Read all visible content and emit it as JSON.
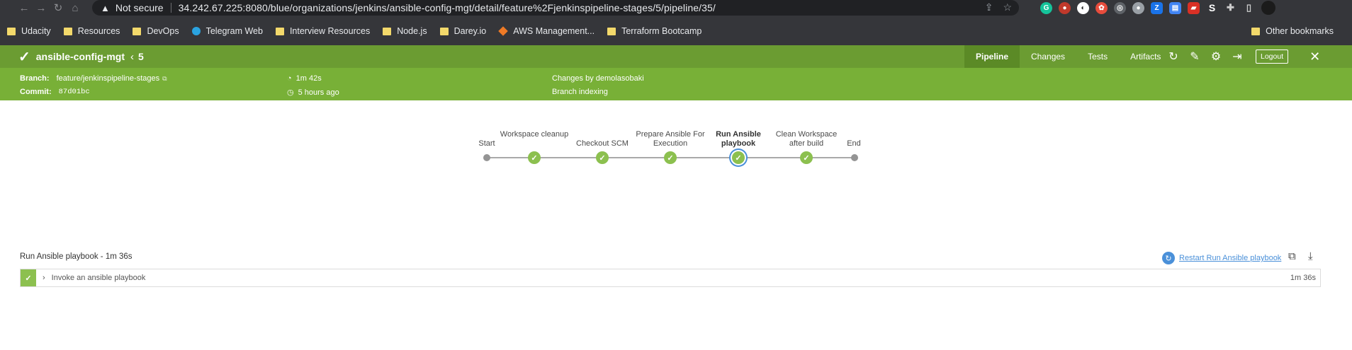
{
  "browser": {
    "not_secure": "Not secure",
    "url": "34.242.67.225:8080/blue/organizations/jenkins/ansible-config-mgt/detail/feature%2Fjenkinspipeline-stages/5/pipeline/35/",
    "bookmarks": [
      "Udacity",
      "Resources",
      "DevOps",
      "Telegram Web",
      "Interview Resources",
      "Node.js",
      "Darey.io",
      "AWS Management...",
      "Terraform Bootcamp"
    ],
    "other_bookmarks": "Other bookmarks"
  },
  "header": {
    "job_name": "ansible-config-mgt",
    "run_number": "5",
    "tabs": [
      "Pipeline",
      "Changes",
      "Tests",
      "Artifacts"
    ],
    "logout": "Logout"
  },
  "summary": {
    "branch_label": "Branch:",
    "branch_value": "feature/jenkinspipeline-stages",
    "commit_label": "Commit:",
    "commit_value": "87d01bc",
    "duration": "1m 42s",
    "time_ago": "5 hours ago",
    "changes": "Changes by demolasobaki",
    "cause": "Branch indexing"
  },
  "pipeline": {
    "stages": [
      {
        "label": "Start"
      },
      {
        "label": "Workspace cleanup"
      },
      {
        "label": "Checkout SCM"
      },
      {
        "label": "Prepare Ansible For Execution"
      },
      {
        "label": "Run Ansible playbook"
      },
      {
        "label": "Clean Workspace after build"
      },
      {
        "label": "End"
      }
    ]
  },
  "details": {
    "title": "Run Ansible playbook - 1m 36s",
    "restart_label": "Restart Run Ansible playbook",
    "step_name": "Invoke an ansible playbook",
    "step_duration": "1m 36s"
  },
  "colors": {
    "header_green": "#6b9c32",
    "subheader_green": "#78b037",
    "success_green": "#8cc04f",
    "link_blue": "#4a90d9"
  }
}
